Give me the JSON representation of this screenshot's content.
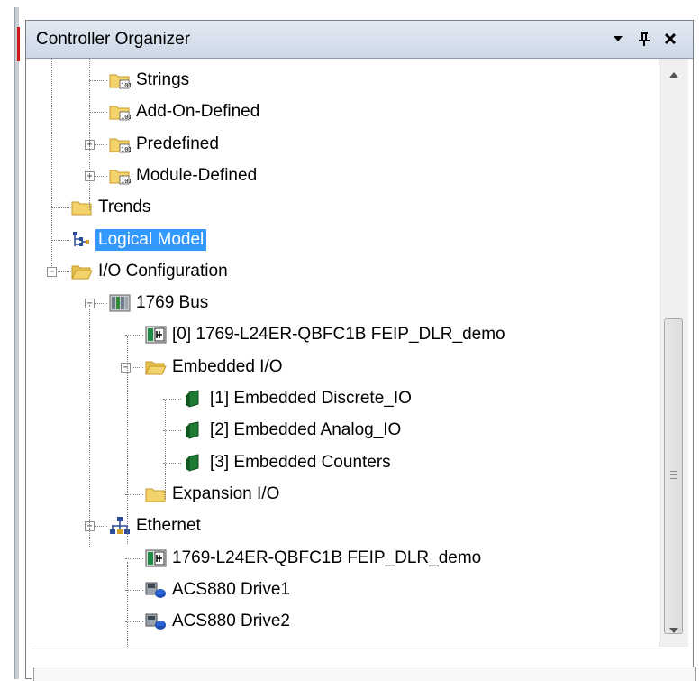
{
  "panel": {
    "title": "Controller Organizer",
    "buttons": {
      "dropdown": "▾",
      "pin": "ᵽ",
      "close": "✕"
    }
  },
  "tree": [
    {
      "label": "Strings",
      "icon": "datatype-folder-icon"
    },
    {
      "label": "Add-On-Defined",
      "icon": "datatype-folder-icon"
    },
    {
      "label": "Predefined",
      "icon": "datatype-folder-icon",
      "expander": "+"
    },
    {
      "label": "Module-Defined",
      "icon": "datatype-folder-icon",
      "expander": "+"
    },
    {
      "label": "Trends",
      "icon": "folder-icon"
    },
    {
      "label": "Logical Model",
      "icon": "logical-model-icon",
      "selected": true
    },
    {
      "label": "I/O Configuration",
      "icon": "open-folder-icon",
      "expander": "−"
    },
    {
      "label": "1769 Bus",
      "icon": "bus-icon",
      "expander": "−"
    },
    {
      "label": "[0] 1769-L24ER-QBFC1B FEIP_DLR_demo",
      "icon": "controller-icon"
    },
    {
      "label": "Embedded I/O",
      "icon": "open-folder-icon",
      "expander": "−"
    },
    {
      "label": "[1] Embedded Discrete_IO",
      "icon": "io-module-icon"
    },
    {
      "label": "[2] Embedded Analog_IO",
      "icon": "io-module-icon"
    },
    {
      "label": "[3] Embedded Counters",
      "icon": "io-module-icon"
    },
    {
      "label": "Expansion I/O",
      "icon": "folder-icon"
    },
    {
      "label": "Ethernet",
      "icon": "ethernet-icon",
      "expander": "−"
    },
    {
      "label": "1769-L24ER-QBFC1B FEIP_DLR_demo",
      "icon": "controller-icon"
    },
    {
      "label": "ACS880 Drive1",
      "icon": "drive-icon"
    },
    {
      "label": "ACS880 Drive2",
      "icon": "drive-icon"
    }
  ],
  "colors": {
    "selection": "#3399ff",
    "folder": "#f3d36b",
    "titlebar": "#d6dfea"
  }
}
